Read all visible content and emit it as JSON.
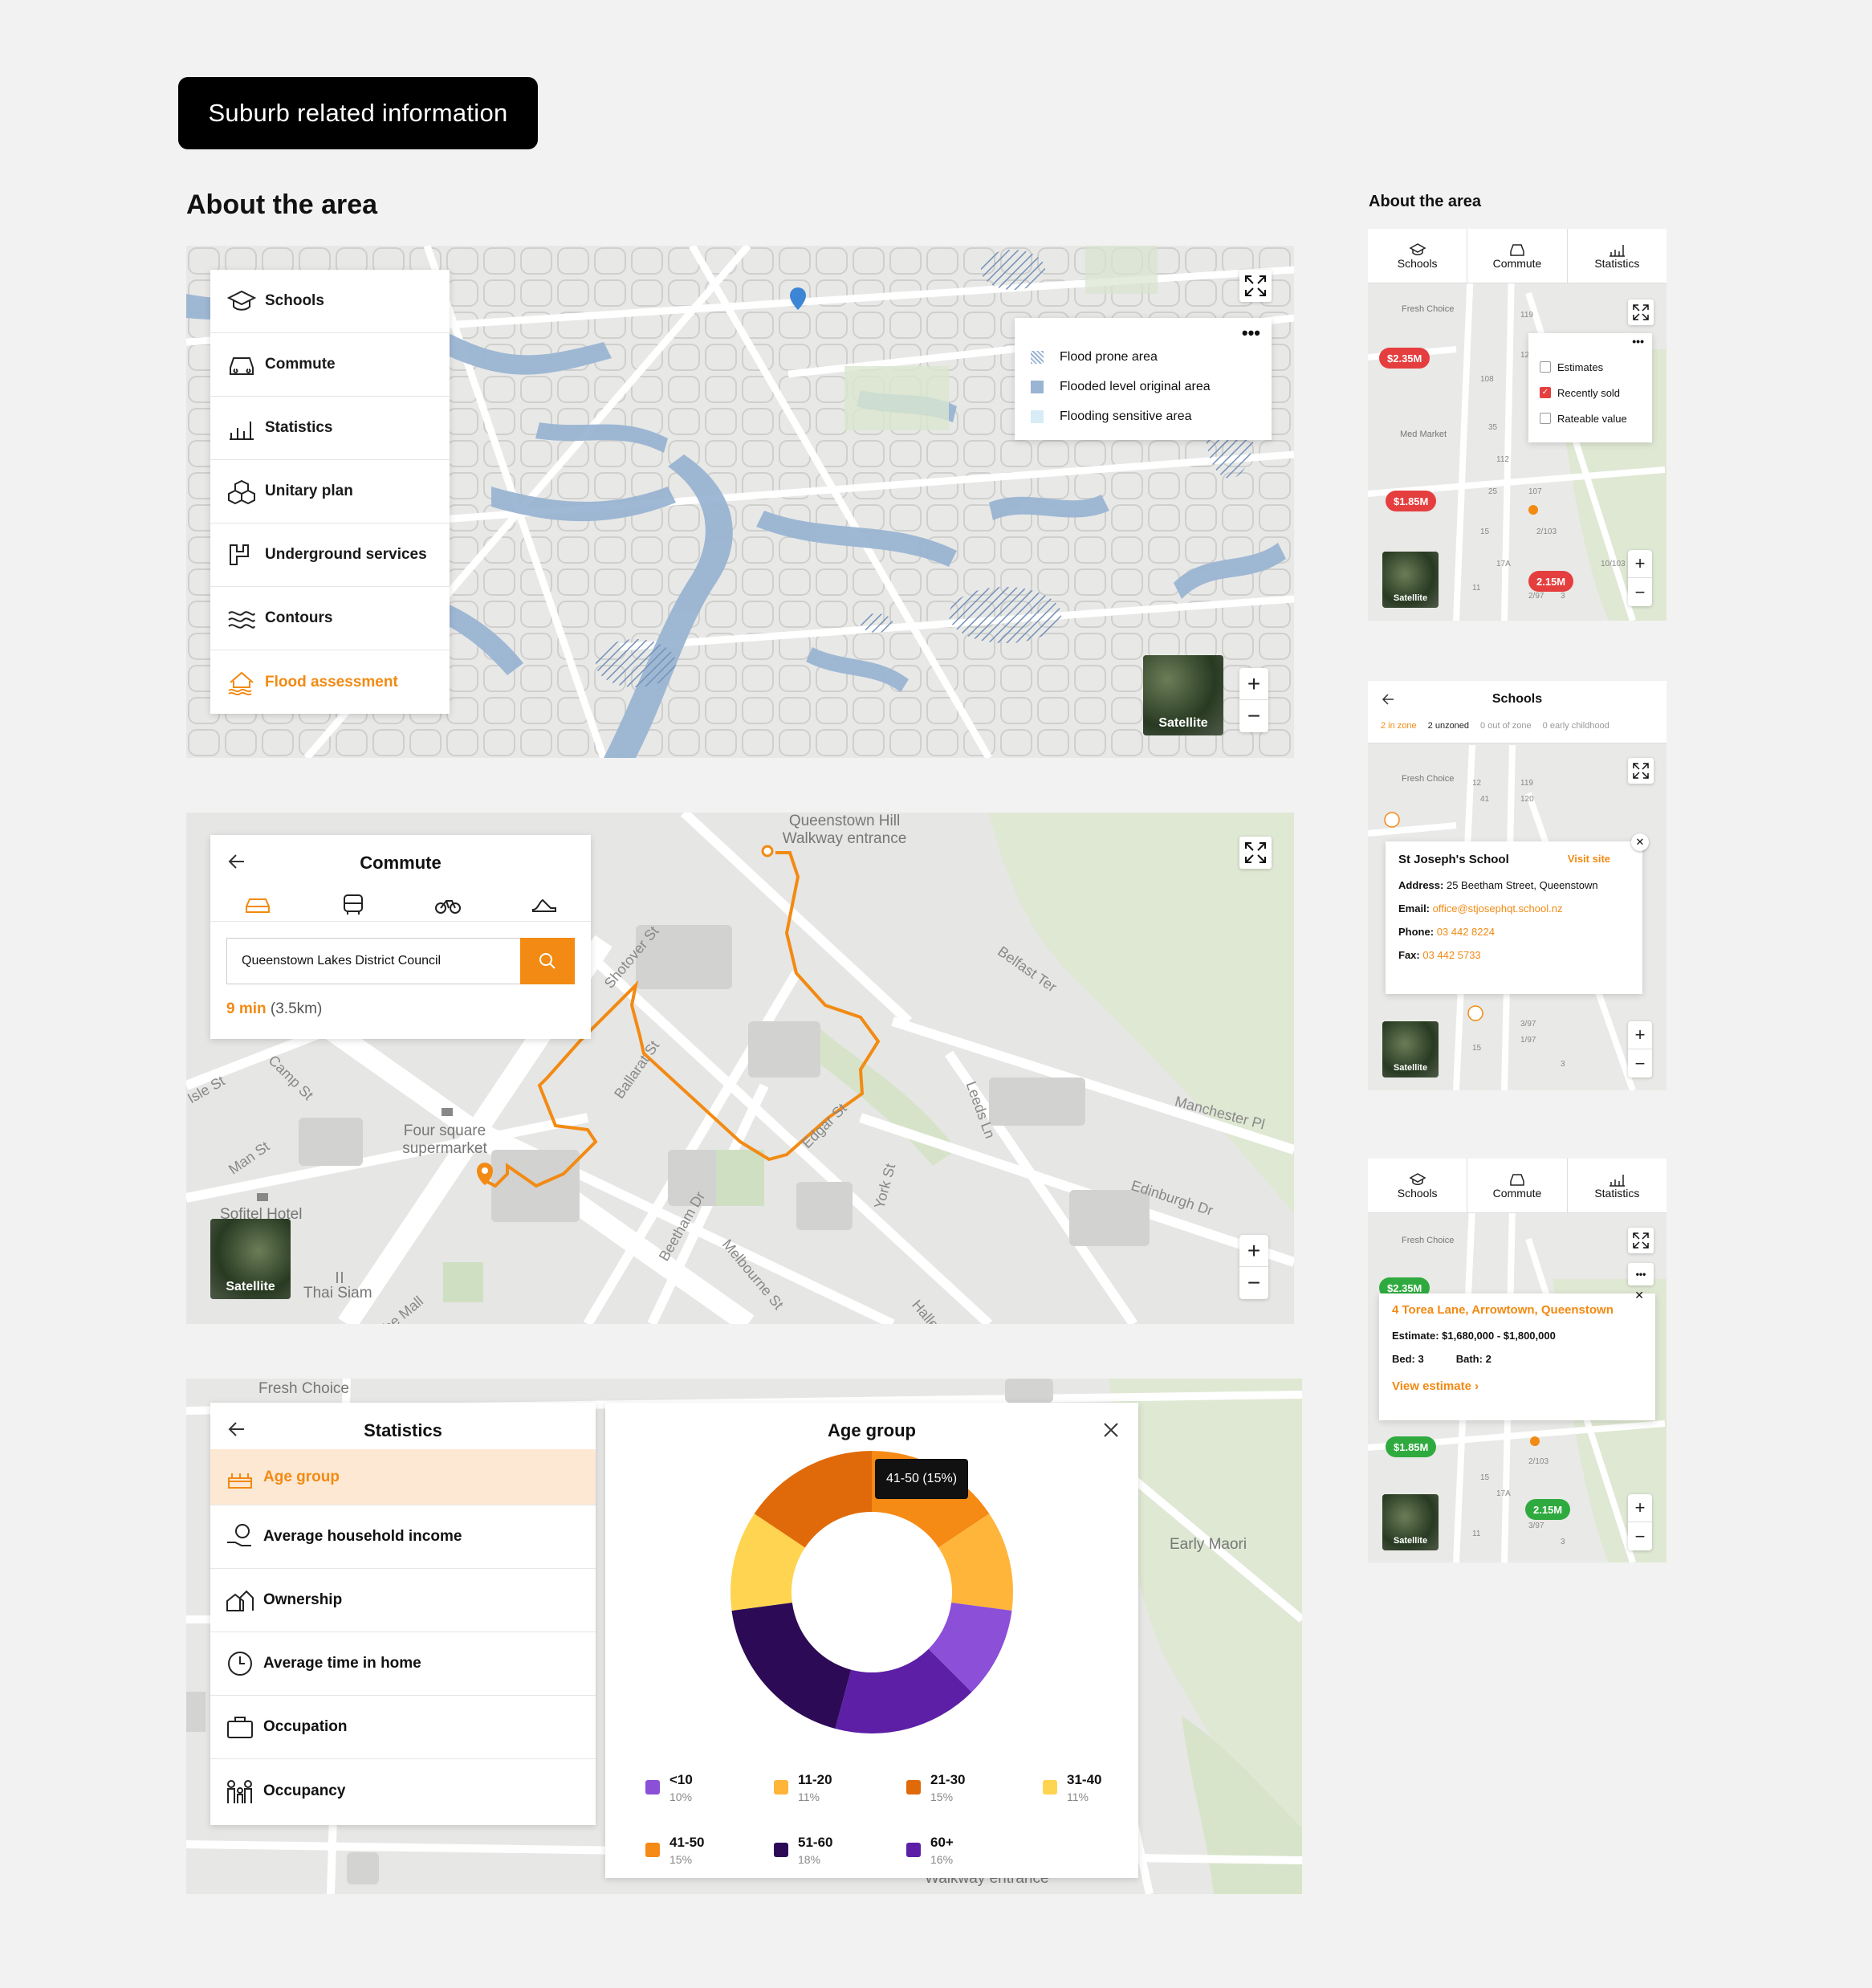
{
  "tag_label": "Suburb related information",
  "main_heading": "About the area",
  "side_heading": "About the area",
  "colors": {
    "accent": "#f28a13",
    "red_pin": "#e53e3e",
    "green_pin": "#2faa3f",
    "flood": "#9ab5d3"
  },
  "map1": {
    "menu": [
      "Schools",
      "Commute",
      "Statistics",
      "Unitary plan",
      "Underground services",
      "Contours",
      "Flood  assessment"
    ],
    "legend": [
      "Flood prone area",
      "Flooded level original area",
      "Flooding sensitive area"
    ],
    "satellite": "Satellite"
  },
  "map2": {
    "title": "Commute",
    "search_value": "Queenstown Lakes District Council",
    "time": "9 min",
    "distance": "(3.5km)",
    "satellite": "Satellite",
    "labels": {
      "walkway": "Queenstown Hill Walkway entrance",
      "supermarket": "Four square supermarket",
      "hotel": "Sofitel Hotel",
      "thai": "Thai Siam",
      "beetham": "Beetham Dr",
      "ballarat": "Ballarat St",
      "edgar": "Edgar St",
      "melbourne": "Melbourne St",
      "york": "York St",
      "leeds": "Leeds Ln",
      "manchester": "Manchester Pl",
      "edinburgh": "Edinburgh Dr",
      "belfast": "Belfast Ter",
      "camp": "Camp St",
      "man": "Man St",
      "isle": "Isle St",
      "mall": "The Mall",
      "shotover": "Shotover St",
      "halle": "Halle"
    }
  },
  "map3": {
    "title": "Statistics",
    "menu": [
      "Age group",
      "Average household income",
      "Ownership",
      "Average time in home",
      "Occupation",
      "Occupancy"
    ],
    "chart_title": "Age group",
    "tooltip": "41-50 (15%)",
    "labels": {
      "fresh": "Fresh Choice",
      "maori": "Early Maori",
      "walkway": "Walkway entrance"
    }
  },
  "chart_data": {
    "type": "pie",
    "title": "Age group",
    "categories": [
      "<10",
      "11-20",
      "21-30",
      "31-40",
      "41-50",
      "51-60",
      "60+"
    ],
    "values": [
      10,
      11,
      15,
      11,
      15,
      18,
      16
    ],
    "value_labels": [
      "10%",
      "11%",
      "15%",
      "11%",
      "15%",
      "18%",
      "16%"
    ],
    "colors": [
      "#8b4fd8",
      "#ffb53a",
      "#e06a0a",
      "#ffd450",
      "#f58a14",
      "#2d0a55",
      "#5c1fa6"
    ],
    "chart_order": [
      4,
      1,
      0,
      6,
      5,
      3,
      2
    ],
    "legend_position": "bottom"
  },
  "side1": {
    "tabs": [
      "Schools",
      "Commute",
      "Statistics"
    ],
    "pins": [
      "$2.35M",
      "$1.85M",
      "2.15M"
    ],
    "options": [
      "Estimates",
      "Recently sold",
      "Rateable value"
    ],
    "satellite": "Satellite",
    "labels": {
      "fresh": "Fresh Choice",
      "med": "Med Market"
    }
  },
  "side2": {
    "title": "Schools",
    "filters": [
      "2 in zone",
      "2 unzoned",
      "0 out of zone",
      "0 early childhood"
    ],
    "school_name": "St Joseph's School",
    "visit": "Visit site",
    "address_label": "Address:",
    "address": "25 Beetham Street, Queenstown",
    "email_label": "Email:",
    "email": "office@stjosephqt.school.nz",
    "phone_label": "Phone:",
    "phone": "03 442 8224",
    "fax_label": "Fax:",
    "fax": "03 442 5733",
    "satellite": "Satellite",
    "labels": {
      "fresh": "Fresh Choice"
    }
  },
  "side3": {
    "tabs": [
      "Schools",
      "Commute",
      "Statistics"
    ],
    "pins": [
      "$2.35M",
      "$1.85M",
      "2.15M"
    ],
    "address": "4 Torea Lane, Arrowtown, Queenstown",
    "estimate_label": "Estimate:",
    "estimate": "$1,680,000 - $1,800,000",
    "bed": "Bed: 3",
    "bath": "Bath: 2",
    "view": "View estimate",
    "satellite": "Satellite",
    "labels": {
      "fresh": "Fresh Choice"
    }
  }
}
